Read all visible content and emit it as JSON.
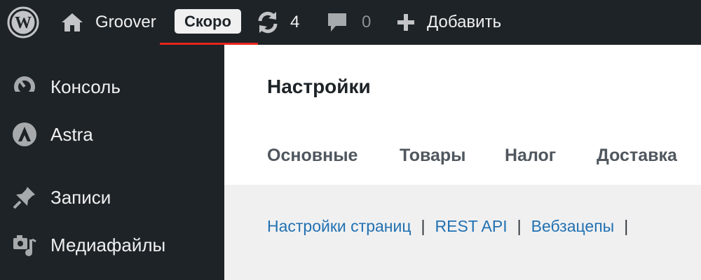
{
  "adminbar": {
    "site_name": "Groover",
    "badge": "Скоро",
    "updates_count": "4",
    "comments_count": "0",
    "new_label": "Добавить"
  },
  "sidebar": {
    "items": [
      {
        "label": "Консоль",
        "icon": "dashboard-icon"
      },
      {
        "label": "Astra",
        "icon": "astra-icon"
      },
      {
        "label": "Записи",
        "icon": "pin-icon"
      },
      {
        "label": "Медиафайлы",
        "icon": "media-icon"
      }
    ]
  },
  "page": {
    "title": "Настройки",
    "tabs": [
      "Основные",
      "Товары",
      "Налог",
      "Доставка"
    ],
    "sublinks": [
      "Настройки страниц",
      "REST API",
      "Вебзацепы"
    ],
    "trailing_sep": "|"
  },
  "colors": {
    "adminbar_bg": "#1d2327",
    "accent_link": "#2271b1",
    "underline": "#e8241c"
  }
}
